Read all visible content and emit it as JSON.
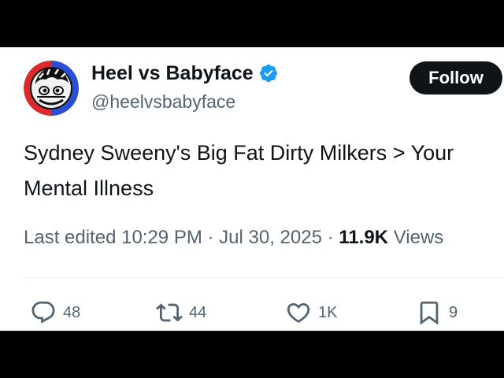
{
  "tweet": {
    "author": {
      "display_name": "Heel vs Babyface",
      "handle": "@heelvsbabyface",
      "verified": true,
      "avatar_icon": "wrestler-face-logo-icon"
    },
    "follow_label": "Follow",
    "text": "Sydney Sweeny's Big Fat Dirty Milkers > Your Mental Illness",
    "meta": {
      "edited_prefix": "Last edited",
      "time": "10:29 PM",
      "separator": "·",
      "date": "Jul 30, 2025",
      "views_count": "11.9K",
      "views_label": "Views"
    },
    "actions": {
      "replies": "48",
      "reposts": "44",
      "likes": "1K",
      "bookmarks": "9"
    }
  },
  "colors": {
    "text_primary": "#0f1419",
    "text_secondary": "#536471",
    "verified_blue": "#1d9bf0",
    "follow_bg": "#0f1419",
    "letterbox": "#000000"
  }
}
